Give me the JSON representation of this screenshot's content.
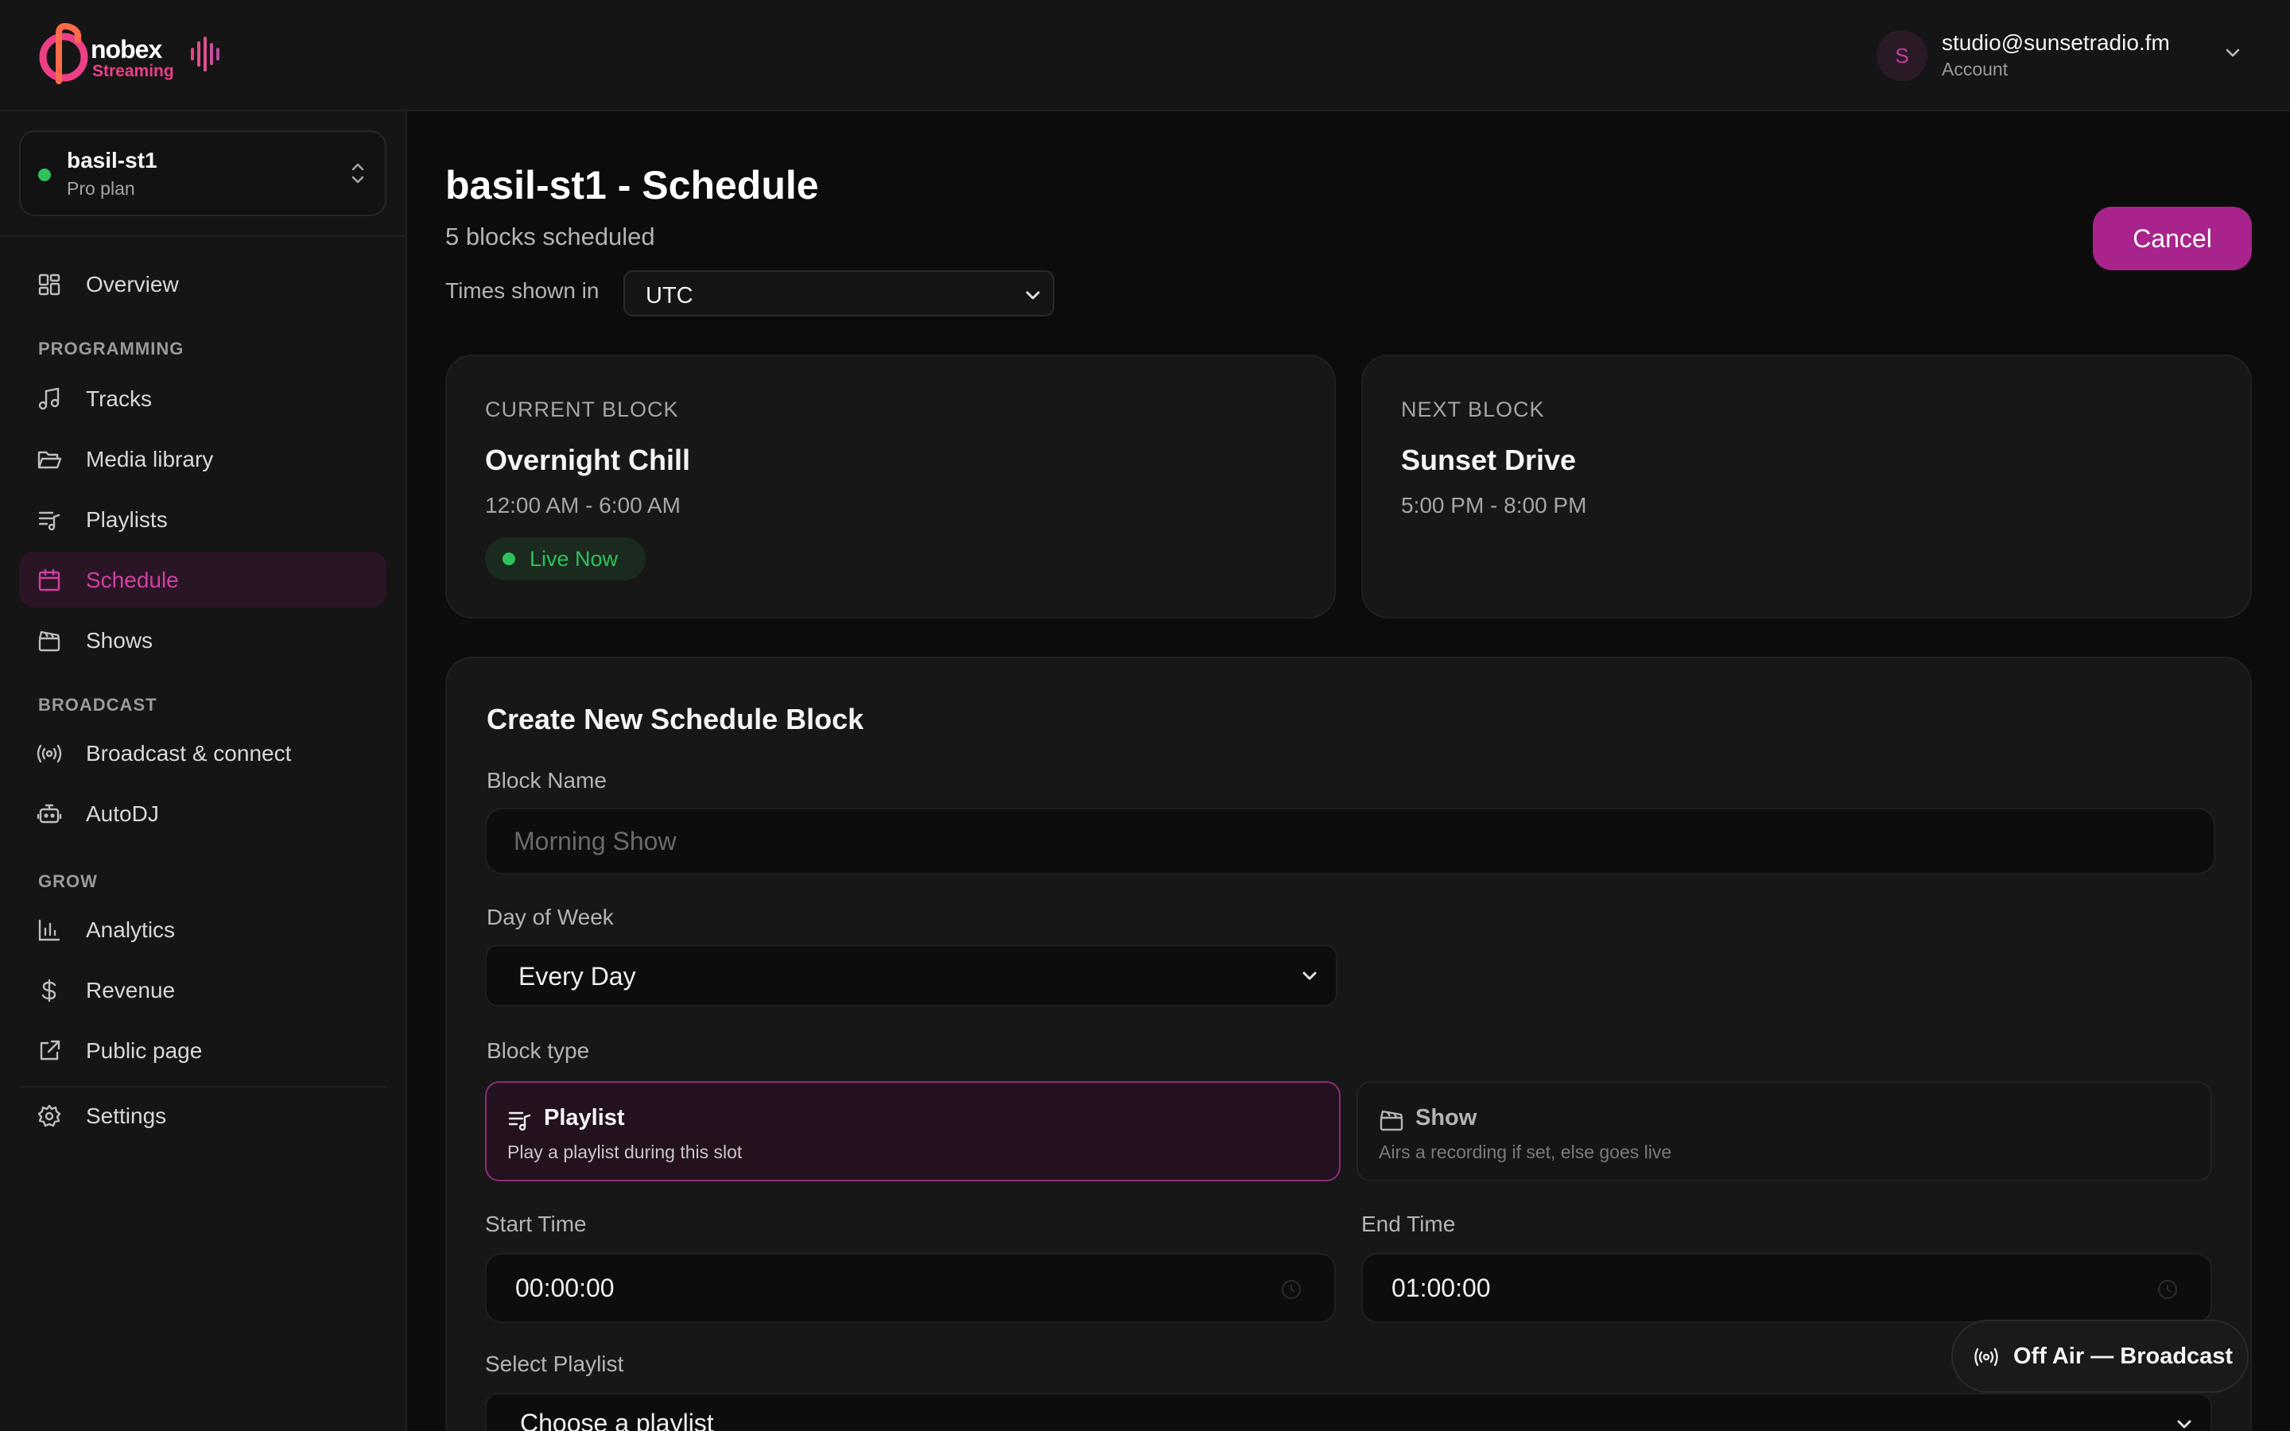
{
  "brand": {
    "name": "nobex",
    "sub": "Streaming",
    "colors": {
      "accent": "#a8238b",
      "active": "#d23fa3",
      "logo": "#ec3f86",
      "live": "#2fc25b"
    }
  },
  "account": {
    "avatar_letter": "S",
    "email": "studio@sunsetradio.fm",
    "label": "Account"
  },
  "station": {
    "name": "basil-st1",
    "plan": "Pro plan"
  },
  "sidebar": {
    "overview": "Overview",
    "sections": {
      "programming": "PROGRAMMING",
      "broadcast": "BROADCAST",
      "grow": "GROW"
    },
    "items": {
      "tracks": "Tracks",
      "media": "Media library",
      "playlists": "Playlists",
      "schedule": "Schedule",
      "shows": "Shows",
      "broadcast": "Broadcast & connect",
      "autodj": "AutoDJ",
      "analytics": "Analytics",
      "revenue": "Revenue",
      "public": "Public page",
      "settings": "Settings"
    }
  },
  "header": {
    "title": "basil-st1 - Schedule",
    "subtitle": "5 blocks scheduled",
    "tz_label": "Times shown in",
    "tz_value": "UTC",
    "cancel": "Cancel"
  },
  "current_block": {
    "tag": "CURRENT BLOCK",
    "name": "Overnight Chill",
    "time": "12:00 AM - 6:00 AM",
    "badge": "Live Now"
  },
  "next_block": {
    "tag": "NEXT BLOCK",
    "name": "Sunset Drive",
    "time": "5:00 PM - 8:00 PM"
  },
  "form": {
    "title": "Create New Schedule Block",
    "block_name_label": "Block Name",
    "block_name_placeholder": "Morning Show",
    "day_label": "Day of Week",
    "day_value": "Every Day",
    "type_label": "Block type",
    "types": {
      "playlist": {
        "name": "Playlist",
        "desc": "Play a playlist during this slot"
      },
      "show": {
        "name": "Show",
        "desc": "Airs a recording if set, else goes live"
      }
    },
    "start_label": "Start Time",
    "start_value": "00:00:00",
    "end_label": "End Time",
    "end_value": "01:00:00",
    "playlist_label": "Select Playlist",
    "playlist_value": "Choose a playlist"
  },
  "broadcast_pill": "Off Air — Broadcast"
}
